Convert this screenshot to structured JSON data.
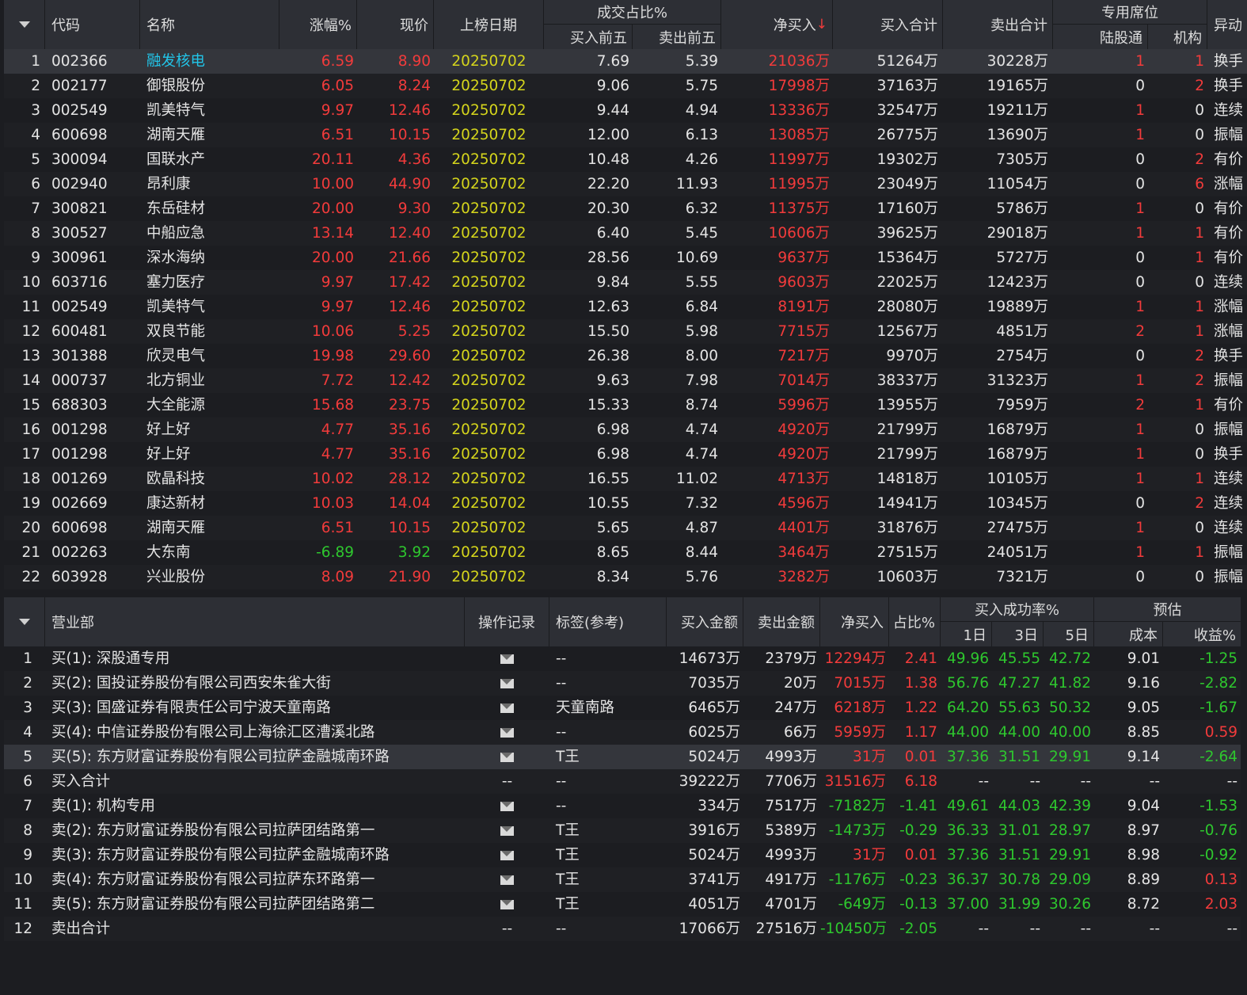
{
  "top_table": {
    "headers": {
      "code": "代码",
      "name": "名称",
      "pct": "涨幅%",
      "price": "现价",
      "date": "上榜日期",
      "ratio_group": "成交占比%",
      "buy_top5": "买入前五",
      "sell_top5": "卖出前五",
      "net": "净买入",
      "sort_arrow": "↓",
      "buy_total": "买入合计",
      "sell_total": "卖出合计",
      "seat_group": "专用席位",
      "hsgt": "陆股通",
      "inst": "机构",
      "reason": "异动"
    },
    "rows": [
      {
        "idx": "1",
        "code": "002366",
        "name": "融发核电",
        "pct": "6.59",
        "price": "8.90",
        "date": "20250702",
        "buy5": "7.69",
        "sell5": "5.39",
        "net": "21036万",
        "buy": "51264万",
        "sell": "30228万",
        "hsgt": "1",
        "inst": "1",
        "reason": "换手"
      },
      {
        "idx": "2",
        "code": "002177",
        "name": "御银股份",
        "pct": "6.05",
        "price": "8.24",
        "date": "20250702",
        "buy5": "9.06",
        "sell5": "5.75",
        "net": "17998万",
        "buy": "37163万",
        "sell": "19165万",
        "hsgt": "0",
        "inst": "2",
        "reason": "换手"
      },
      {
        "idx": "3",
        "code": "002549",
        "name": "凯美特气",
        "pct": "9.97",
        "price": "12.46",
        "date": "20250702",
        "buy5": "9.44",
        "sell5": "4.94",
        "net": "13336万",
        "buy": "32547万",
        "sell": "19211万",
        "hsgt": "1",
        "inst": "0",
        "reason": "连续"
      },
      {
        "idx": "4",
        "code": "600698",
        "name": "湖南天雁",
        "pct": "6.51",
        "price": "10.15",
        "date": "20250702",
        "buy5": "12.00",
        "sell5": "6.13",
        "net": "13085万",
        "buy": "26775万",
        "sell": "13690万",
        "hsgt": "1",
        "inst": "0",
        "reason": "振幅"
      },
      {
        "idx": "5",
        "code": "300094",
        "name": "国联水产",
        "pct": "20.11",
        "price": "4.36",
        "date": "20250702",
        "buy5": "10.48",
        "sell5": "4.26",
        "net": "11997万",
        "buy": "19302万",
        "sell": "7305万",
        "hsgt": "0",
        "inst": "2",
        "reason": "有价"
      },
      {
        "idx": "6",
        "code": "002940",
        "name": "昂利康",
        "pct": "10.00",
        "price": "44.90",
        "date": "20250702",
        "buy5": "22.20",
        "sell5": "11.93",
        "net": "11995万",
        "buy": "23049万",
        "sell": "11054万",
        "hsgt": "0",
        "inst": "6",
        "reason": "涨幅"
      },
      {
        "idx": "7",
        "code": "300821",
        "name": "东岳硅材",
        "pct": "20.00",
        "price": "9.30",
        "date": "20250702",
        "buy5": "20.30",
        "sell5": "6.32",
        "net": "11375万",
        "buy": "17160万",
        "sell": "5786万",
        "hsgt": "1",
        "inst": "0",
        "reason": "有价"
      },
      {
        "idx": "8",
        "code": "300527",
        "name": "中船应急",
        "pct": "13.14",
        "price": "12.40",
        "date": "20250702",
        "buy5": "6.40",
        "sell5": "5.45",
        "net": "10606万",
        "buy": "39625万",
        "sell": "29018万",
        "hsgt": "1",
        "inst": "1",
        "reason": "有价"
      },
      {
        "idx": "9",
        "code": "300961",
        "name": "深水海纳",
        "pct": "20.00",
        "price": "21.66",
        "date": "20250702",
        "buy5": "28.56",
        "sell5": "10.69",
        "net": "9637万",
        "buy": "15364万",
        "sell": "5727万",
        "hsgt": "0",
        "inst": "1",
        "reason": "有价"
      },
      {
        "idx": "10",
        "code": "603716",
        "name": "塞力医疗",
        "pct": "9.97",
        "price": "17.42",
        "date": "20250702",
        "buy5": "9.84",
        "sell5": "5.55",
        "net": "9603万",
        "buy": "22025万",
        "sell": "12423万",
        "hsgt": "0",
        "inst": "0",
        "reason": "连续"
      },
      {
        "idx": "11",
        "code": "002549",
        "name": "凯美特气",
        "pct": "9.97",
        "price": "12.46",
        "date": "20250702",
        "buy5": "12.63",
        "sell5": "6.84",
        "net": "8191万",
        "buy": "28080万",
        "sell": "19889万",
        "hsgt": "1",
        "inst": "1",
        "reason": "涨幅"
      },
      {
        "idx": "12",
        "code": "600481",
        "name": "双良节能",
        "pct": "10.06",
        "price": "5.25",
        "date": "20250702",
        "buy5": "15.50",
        "sell5": "5.98",
        "net": "7715万",
        "buy": "12567万",
        "sell": "4851万",
        "hsgt": "2",
        "inst": "1",
        "reason": "涨幅"
      },
      {
        "idx": "13",
        "code": "301388",
        "name": "欣灵电气",
        "pct": "19.98",
        "price": "29.60",
        "date": "20250702",
        "buy5": "26.38",
        "sell5": "8.00",
        "net": "7217万",
        "buy": "9970万",
        "sell": "2754万",
        "hsgt": "0",
        "inst": "2",
        "reason": "换手"
      },
      {
        "idx": "14",
        "code": "000737",
        "name": "北方铜业",
        "pct": "7.72",
        "price": "12.42",
        "date": "20250702",
        "buy5": "9.63",
        "sell5": "7.98",
        "net": "7014万",
        "buy": "38337万",
        "sell": "31323万",
        "hsgt": "1",
        "inst": "2",
        "reason": "振幅"
      },
      {
        "idx": "15",
        "code": "688303",
        "name": "大全能源",
        "pct": "15.68",
        "price": "23.75",
        "date": "20250702",
        "buy5": "15.33",
        "sell5": "8.74",
        "net": "5996万",
        "buy": "13955万",
        "sell": "7959万",
        "hsgt": "2",
        "inst": "1",
        "reason": "有价"
      },
      {
        "idx": "16",
        "code": "001298",
        "name": "好上好",
        "pct": "4.77",
        "price": "35.16",
        "date": "20250702",
        "buy5": "6.98",
        "sell5": "4.74",
        "net": "4920万",
        "buy": "21799万",
        "sell": "16879万",
        "hsgt": "1",
        "inst": "0",
        "reason": "振幅"
      },
      {
        "idx": "17",
        "code": "001298",
        "name": "好上好",
        "pct": "4.77",
        "price": "35.16",
        "date": "20250702",
        "buy5": "6.98",
        "sell5": "4.74",
        "net": "4920万",
        "buy": "21799万",
        "sell": "16879万",
        "hsgt": "1",
        "inst": "0",
        "reason": "换手"
      },
      {
        "idx": "18",
        "code": "001269",
        "name": "欧晶科技",
        "pct": "10.02",
        "price": "28.12",
        "date": "20250702",
        "buy5": "16.55",
        "sell5": "11.02",
        "net": "4713万",
        "buy": "14818万",
        "sell": "10105万",
        "hsgt": "1",
        "inst": "1",
        "reason": "连续"
      },
      {
        "idx": "19",
        "code": "002669",
        "name": "康达新材",
        "pct": "10.03",
        "price": "14.04",
        "date": "20250702",
        "buy5": "10.55",
        "sell5": "7.32",
        "net": "4596万",
        "buy": "14941万",
        "sell": "10345万",
        "hsgt": "0",
        "inst": "2",
        "reason": "连续"
      },
      {
        "idx": "20",
        "code": "600698",
        "name": "湖南天雁",
        "pct": "6.51",
        "price": "10.15",
        "date": "20250702",
        "buy5": "5.65",
        "sell5": "4.87",
        "net": "4401万",
        "buy": "31876万",
        "sell": "27475万",
        "hsgt": "1",
        "inst": "0",
        "reason": "连续"
      },
      {
        "idx": "21",
        "code": "002263",
        "name": "大东南",
        "pct": "-6.89",
        "price": "3.92",
        "date": "20250702",
        "buy5": "8.65",
        "sell5": "8.44",
        "net": "3464万",
        "buy": "27515万",
        "sell": "24051万",
        "hsgt": "1",
        "inst": "1",
        "reason": "振幅"
      },
      {
        "idx": "22",
        "code": "603928",
        "name": "兴业股份",
        "pct": "8.09",
        "price": "21.90",
        "date": "20250702",
        "buy5": "8.34",
        "sell5": "5.76",
        "net": "3282万",
        "buy": "10603万",
        "sell": "7321万",
        "hsgt": "0",
        "inst": "0",
        "reason": "振幅"
      }
    ]
  },
  "bottom_table": {
    "headers": {
      "dept": "营业部",
      "record": "操作记录",
      "tag": "标签(参考)",
      "buy_amt": "买入金额",
      "sell_amt": "卖出金额",
      "net": "净买入",
      "ratio": "占比%",
      "success_group": "买入成功率%",
      "d1": "1日",
      "d3": "3日",
      "d5": "5日",
      "est_group": "预估",
      "cost": "成本",
      "ret": "收益%"
    },
    "rows": [
      {
        "idx": "1",
        "dept": "买(1): 深股通专用",
        "mail": true,
        "tag": "--",
        "buy": "14673万",
        "sell": "2379万",
        "net": "12294万",
        "ratio": "2.41",
        "d1": "49.96",
        "d3": "45.55",
        "d5": "42.72",
        "cost": "9.01",
        "ret": "-1.25"
      },
      {
        "idx": "2",
        "dept": "买(2): 国投证券股份有限公司西安朱雀大街",
        "mail": true,
        "tag": "--",
        "buy": "7035万",
        "sell": "20万",
        "net": "7015万",
        "ratio": "1.38",
        "d1": "56.76",
        "d3": "47.27",
        "d5": "41.82",
        "cost": "9.16",
        "ret": "-2.82"
      },
      {
        "idx": "3",
        "dept": "买(3): 国盛证券有限责任公司宁波天童南路",
        "mail": true,
        "tag": "天童南路",
        "buy": "6465万",
        "sell": "247万",
        "net": "6218万",
        "ratio": "1.22",
        "d1": "64.20",
        "d3": "55.63",
        "d5": "50.32",
        "cost": "9.05",
        "ret": "-1.67"
      },
      {
        "idx": "4",
        "dept": "买(4): 中信证券股份有限公司上海徐汇区漕溪北路",
        "mail": true,
        "tag": "--",
        "buy": "6025万",
        "sell": "66万",
        "net": "5959万",
        "ratio": "1.17",
        "d1": "44.00",
        "d3": "44.00",
        "d5": "40.00",
        "cost": "8.85",
        "ret": "0.59"
      },
      {
        "idx": "5",
        "dept": "买(5): 东方财富证券股份有限公司拉萨金融城南环路",
        "mail": true,
        "tag": "T王",
        "buy": "5024万",
        "sell": "4993万",
        "net": "31万",
        "ratio": "0.01",
        "d1": "37.36",
        "d3": "31.51",
        "d5": "29.91",
        "cost": "9.14",
        "ret": "-2.64"
      },
      {
        "idx": "6",
        "dept": "买入合计",
        "mail": false,
        "rec": "--",
        "tag": "--",
        "buy": "39222万",
        "sell": "7706万",
        "net": "31516万",
        "ratio": "6.18",
        "d1": "--",
        "d3": "--",
        "d5": "--",
        "cost": "--",
        "ret": "--"
      },
      {
        "idx": "7",
        "dept": "卖(1): 机构专用",
        "mail": true,
        "tag": "--",
        "buy": "334万",
        "sell": "7517万",
        "net": "-7182万",
        "ratio": "-1.41",
        "d1": "49.61",
        "d3": "44.03",
        "d5": "42.39",
        "cost": "9.04",
        "ret": "-1.53"
      },
      {
        "idx": "8",
        "dept": "卖(2): 东方财富证券股份有限公司拉萨团结路第一",
        "mail": true,
        "tag": "T王",
        "buy": "3916万",
        "sell": "5389万",
        "net": "-1473万",
        "ratio": "-0.29",
        "d1": "36.33",
        "d3": "31.01",
        "d5": "28.97",
        "cost": "8.97",
        "ret": "-0.76"
      },
      {
        "idx": "9",
        "dept": "卖(3): 东方财富证券股份有限公司拉萨金融城南环路",
        "mail": true,
        "tag": "T王",
        "buy": "5024万",
        "sell": "4993万",
        "net": "31万",
        "ratio": "0.01",
        "d1": "37.36",
        "d3": "31.51",
        "d5": "29.91",
        "cost": "8.98",
        "ret": "-0.92"
      },
      {
        "idx": "10",
        "dept": "卖(4): 东方财富证券股份有限公司拉萨东环路第一",
        "mail": true,
        "tag": "T王",
        "buy": "3741万",
        "sell": "4917万",
        "net": "-1176万",
        "ratio": "-0.23",
        "d1": "36.37",
        "d3": "30.78",
        "d5": "29.09",
        "cost": "8.89",
        "ret": "0.13"
      },
      {
        "idx": "11",
        "dept": "卖(5): 东方财富证券股份有限公司拉萨团结路第二",
        "mail": true,
        "tag": "T王",
        "buy": "4051万",
        "sell": "4701万",
        "net": "-649万",
        "ratio": "-0.13",
        "d1": "37.00",
        "d3": "31.99",
        "d5": "30.26",
        "cost": "8.72",
        "ret": "2.03"
      },
      {
        "idx": "12",
        "dept": "卖出合计",
        "mail": false,
        "rec": "--",
        "tag": "--",
        "buy": "17066万",
        "sell": "27516万",
        "net": "-10450万",
        "ratio": "-2.05",
        "d1": "--",
        "d3": "--",
        "d5": "--",
        "cost": "--",
        "ret": "--"
      }
    ]
  },
  "colors": {
    "up": "#f23b3b",
    "down": "#2ec72e",
    "date": "#d5d51c",
    "link": "#22c4e8",
    "header_bg": "#2d2f35",
    "bg": "#1c1d21"
  },
  "selected_row": "1",
  "highlighted_bottom_row": "5"
}
